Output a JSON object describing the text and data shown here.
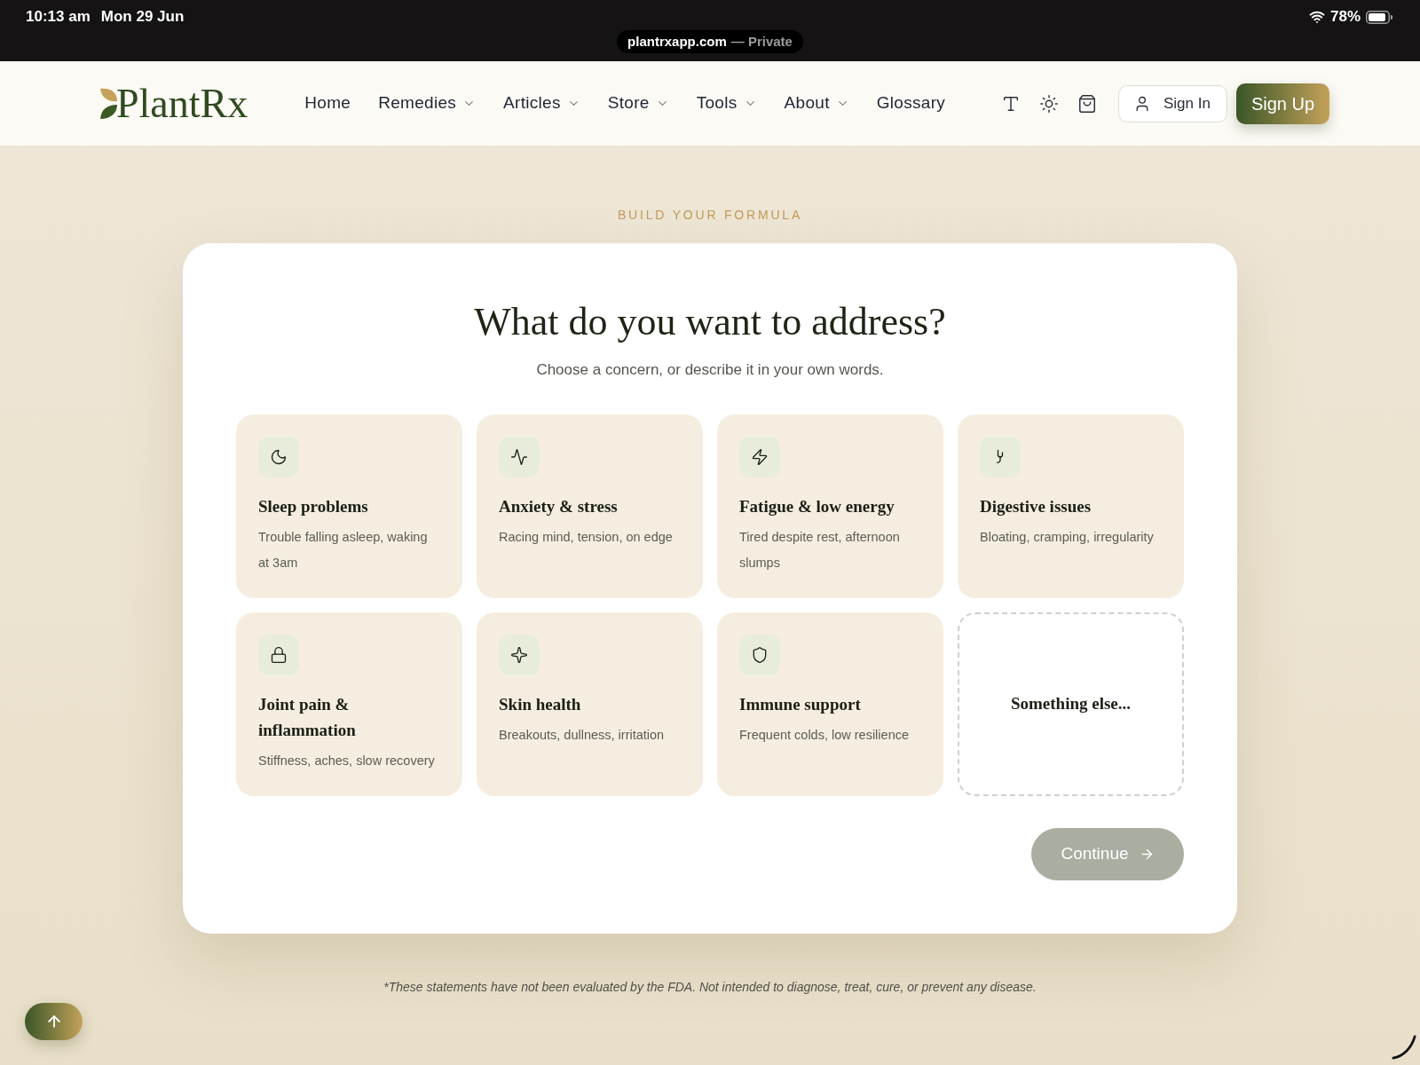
{
  "status_bar": {
    "time": "10:13 am",
    "date": "Mon 29 Jun",
    "url": "plantrxapp.com",
    "browsing_mode": "— Private",
    "battery": "78%"
  },
  "nav": {
    "logo": "PlantRx",
    "items": [
      {
        "label": "Home",
        "has_menu": false
      },
      {
        "label": "Remedies",
        "has_menu": true
      },
      {
        "label": "Articles",
        "has_menu": true
      },
      {
        "label": "Store",
        "has_menu": true
      },
      {
        "label": "Tools",
        "has_menu": true
      },
      {
        "label": "About",
        "has_menu": true
      },
      {
        "label": "Glossary",
        "has_menu": false
      }
    ],
    "sign_in": "Sign In",
    "sign_up": "Sign Up"
  },
  "eyebrow": "BUILD YOUR FORMULA",
  "heading": "What do you want to address?",
  "subtitle": "Choose a concern, or describe it in your own words.",
  "concerns": [
    {
      "kind": "preset",
      "title": "Sleep problems",
      "description": "Trouble falling asleep, waking at 3am",
      "selected": false
    },
    {
      "kind": "preset",
      "title": "Anxiety & stress",
      "description": "Racing mind, tension, on edge",
      "selected": false
    },
    {
      "kind": "preset",
      "title": "Fatigue & low energy",
      "description": "Tired despite rest, afternoon slumps",
      "selected": false
    },
    {
      "kind": "preset",
      "title": "Digestive issues",
      "description": "Bloating, cramping, irregularity",
      "selected": false
    },
    {
      "kind": "preset",
      "title": "Joint pain & inflammation",
      "description": "Stiffness, aches, slow recovery",
      "selected": false
    },
    {
      "kind": "preset",
      "title": "Skin health",
      "description": "Breakouts, dullness, irritation",
      "selected": false
    },
    {
      "kind": "preset",
      "title": "Immune support",
      "description": "Frequent colds, low resilience",
      "selected": false
    },
    {
      "kind": "custom",
      "title": "Something else...",
      "selected": false
    }
  ],
  "continue_button": {
    "label": "Continue",
    "disabled": true
  },
  "disclaimer": "*These statements have not been evaluated by the FDA. Not intended to diagnose, treat, cure, or prevent any disease."
}
